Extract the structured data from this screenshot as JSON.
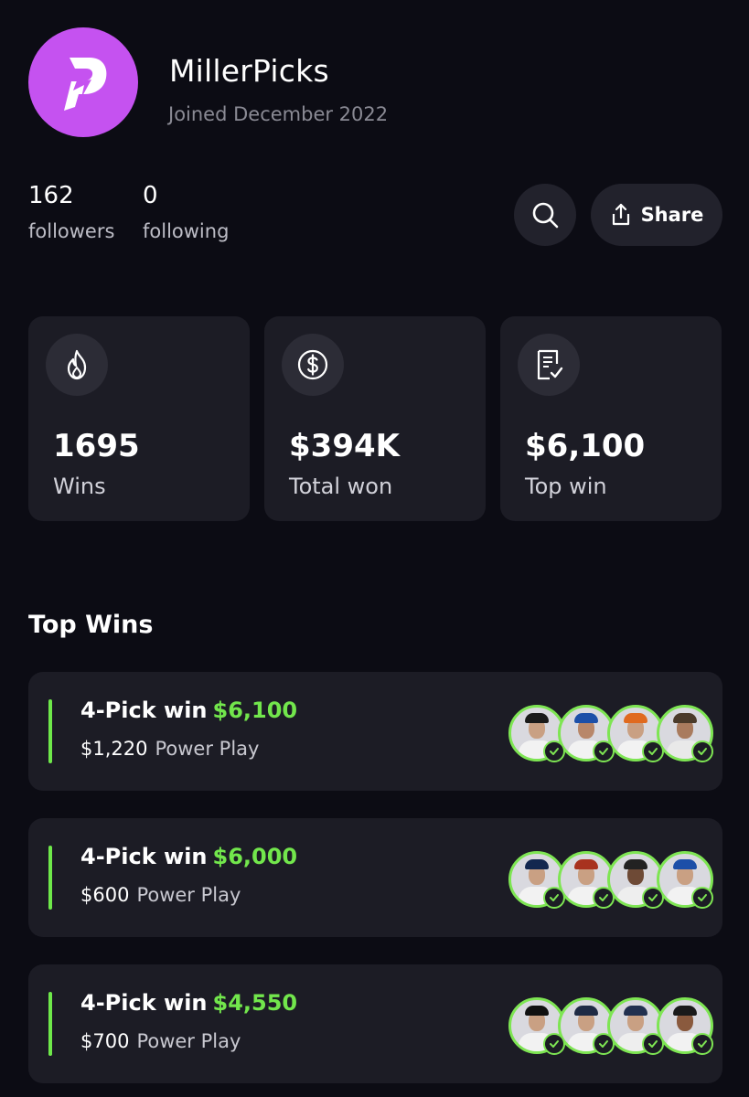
{
  "profile": {
    "username": "MillerPicks",
    "joined": "Joined December 2022",
    "brand_color": "#c552f0"
  },
  "social": {
    "followers_count": "162",
    "followers_label": "followers",
    "following_count": "0",
    "following_label": "following"
  },
  "actions": {
    "search_icon": "search-icon",
    "share_label": "Share"
  },
  "stats": [
    {
      "icon": "flame-icon",
      "value": "1695",
      "label": "Wins"
    },
    {
      "icon": "dollar-icon",
      "value": "$394K",
      "label": "Total won"
    },
    {
      "icon": "receipt-check-icon",
      "value": "$6,100",
      "label": "Top win"
    }
  ],
  "top_wins": {
    "title": "Top Wins",
    "items": [
      {
        "pick_label": "4-Pick win",
        "payout": "$6,100",
        "entry": "$1,220",
        "type": "Power Play",
        "player_count": 4
      },
      {
        "pick_label": "4-Pick win",
        "payout": "$6,000",
        "entry": "$600",
        "type": "Power Play",
        "player_count": 4
      },
      {
        "pick_label": "4-Pick win",
        "payout": "$4,550",
        "entry": "$700",
        "type": "Power Play",
        "player_count": 4
      }
    ]
  },
  "colors": {
    "background": "#0c0c14",
    "card": "#1c1c25",
    "accent_green": "#72e64c"
  }
}
